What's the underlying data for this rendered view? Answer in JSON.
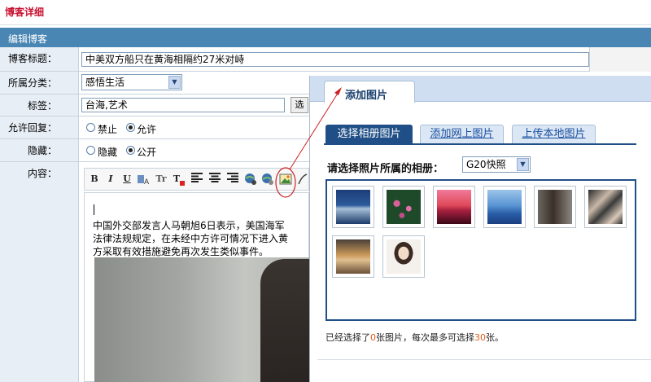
{
  "page": {
    "title": "博客详细",
    "section": "编辑博客"
  },
  "form": {
    "title_label": "博客标题：",
    "title_value": "中美双方船只在黄海相隔约27米对峙",
    "category_label": "所属分类：",
    "category_value": "感悟生活",
    "tags_label": "标签：",
    "tags_value": "台海,艺术",
    "tags_button": "选",
    "reply_label": "允许回复：",
    "reply_opt_no": "禁止",
    "reply_opt_yes": "允许",
    "hide_label": "隐藏：",
    "hide_opt_hide": "隐藏",
    "hide_opt_public": "公开",
    "content_label": "内容："
  },
  "editor": {
    "toolbar": {
      "bold": "B",
      "italic": "I",
      "underline": "U",
      "font": "Tr",
      "color": "T"
    },
    "content_lines": [
      "中国外交部发言人马朝旭6日表示，美国海军",
      "法律法规规定，在未经中方许可情况下进入黄",
      "方采取有效措施避免再次发生类似事件。"
    ]
  },
  "dialog": {
    "tab": "添加图片",
    "subtabs": [
      "选择相册图片",
      "添加网上图片",
      "上传本地图片"
    ],
    "album_prompt": "请选择照片所属的相册：",
    "album_value": "G20快照",
    "status_before": "已经选择了",
    "status_selected": "0",
    "status_mid": "张图片，每次最多可选择",
    "status_max": "30",
    "status_after": "张。"
  },
  "colors": {
    "accent": "#4a86b4",
    "tab_active": "#1f4f86",
    "page_title": "#c8102e",
    "annotation": "#cc2222"
  }
}
